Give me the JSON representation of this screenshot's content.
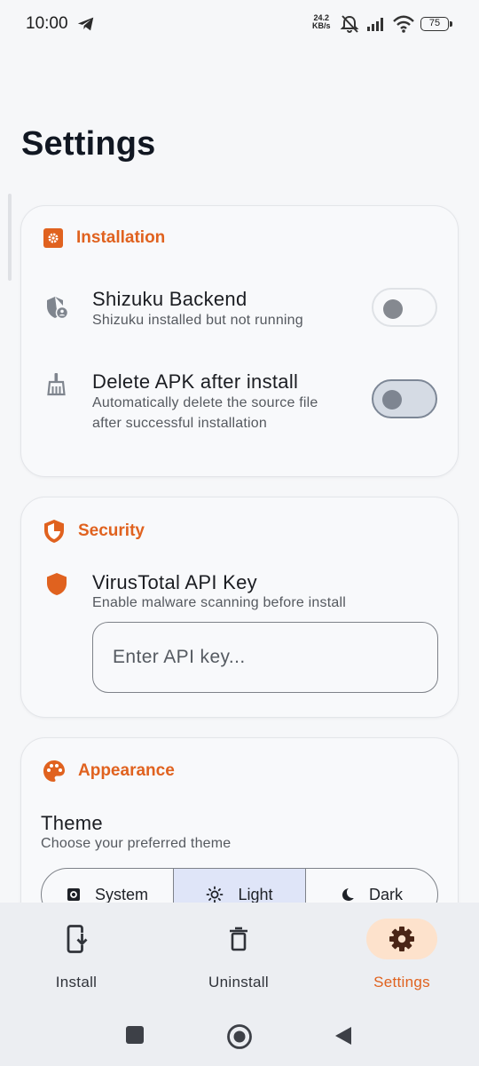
{
  "status_bar": {
    "time": "10:00",
    "net_speed_value": "24.2",
    "net_speed_unit": "KB/s",
    "battery": "75",
    "icons": [
      "telegram-icon",
      "alarm-off-icon",
      "signal-icon",
      "wifi-icon",
      "battery-icon"
    ]
  },
  "page": {
    "title": "Settings"
  },
  "installation": {
    "header": "Installation",
    "shizuku": {
      "title": "Shizuku Backend",
      "subtitle": "Shizuku installed but not running",
      "enabled": false
    },
    "delete_apk": {
      "title": "Delete APK after install",
      "subtitle_line1": "Automatically delete the source file",
      "subtitle_line2": "after successful installation",
      "enabled": false
    }
  },
  "security": {
    "header": "Security",
    "virustotal": {
      "title": "VirusTotal API Key",
      "subtitle": "Enable malware scanning before install",
      "input_value": "",
      "input_placeholder": "Enter API key..."
    }
  },
  "appearance": {
    "header": "Appearance",
    "theme": {
      "title": "Theme",
      "subtitle": "Choose your preferred theme",
      "options": [
        "System",
        "Light",
        "Dark"
      ],
      "selected": "Light"
    }
  },
  "bottom_nav": {
    "items": [
      {
        "label": "Install",
        "icon": "install-icon"
      },
      {
        "label": "Uninstall",
        "icon": "trash-icon"
      },
      {
        "label": "Settings",
        "icon": "gear-icon"
      }
    ],
    "active": "Settings"
  },
  "colors": {
    "accent": "#e0621f",
    "background": "#f6f7f9",
    "selected_segment": "#dfe5f8",
    "active_nav_pill": "#fde2cc"
  }
}
